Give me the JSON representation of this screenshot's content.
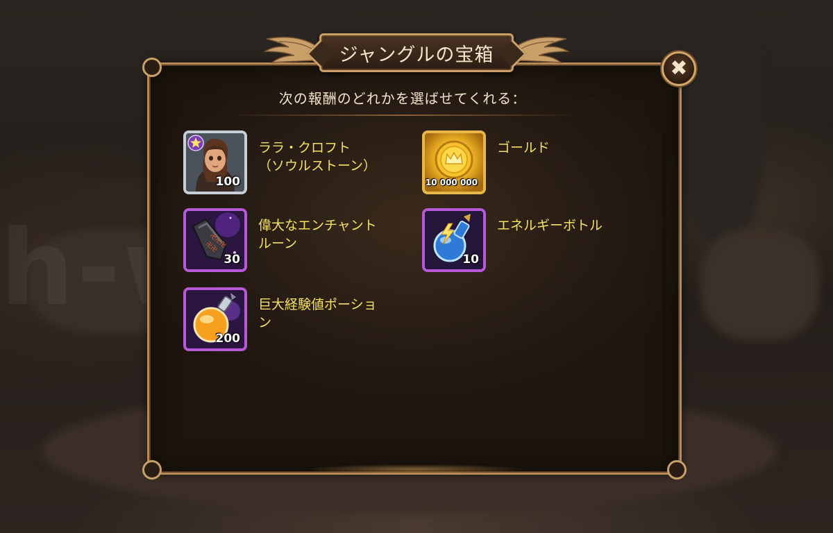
{
  "dialog": {
    "title": "ジャングルの宝箱",
    "subtitle": "次の報酬のどれかを選ばせてくれる：",
    "close_label": "✖"
  },
  "background": {
    "watermark": "h-w fun"
  },
  "rewards": [
    {
      "name": "ララ・クロフト\n（ソウルストーン）",
      "quantity": "100",
      "frame": "silver",
      "icon": "lara-croft-soulstone-icon"
    },
    {
      "name": "ゴールド",
      "quantity": "10 000 000",
      "frame": "gold",
      "icon": "gold-coin-icon"
    },
    {
      "name": "偉大なエンチャント\nルーン",
      "quantity": "30",
      "frame": "purple",
      "icon": "enchant-rune-icon"
    },
    {
      "name": "エネルギーボトル",
      "quantity": "10",
      "frame": "purple",
      "icon": "energy-bottle-icon"
    },
    {
      "name": "巨大経験値ポーショ\nン",
      "quantity": "200",
      "frame": "purple",
      "icon": "experience-potion-icon"
    }
  ],
  "colors": {
    "label_yellow": "#f5e264",
    "panel_border": "#b58a55",
    "purple_frame": "#b65ad8",
    "gold_frame": "#e7b74a",
    "silver_frame": "#c8ced6"
  }
}
